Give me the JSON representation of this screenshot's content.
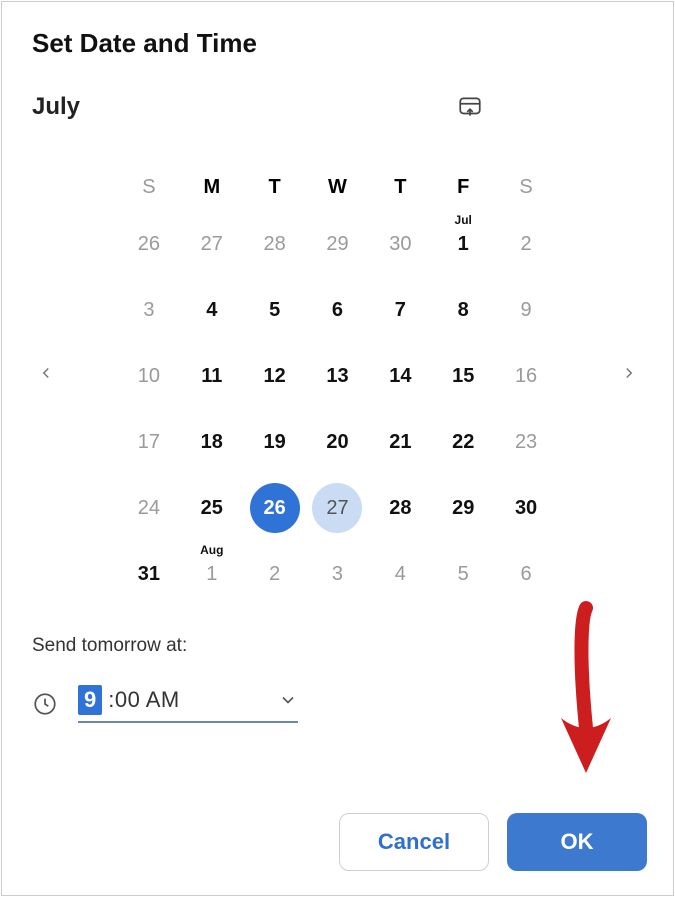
{
  "title": "Set Date and Time",
  "month": "July",
  "dow": [
    "S",
    "M",
    "T",
    "W",
    "T",
    "F",
    "S"
  ],
  "weeks": [
    [
      {
        "n": "26",
        "in": false
      },
      {
        "n": "27",
        "in": false
      },
      {
        "n": "28",
        "in": false
      },
      {
        "n": "29",
        "in": false
      },
      {
        "n": "30",
        "in": false
      },
      {
        "n": "1",
        "in": true,
        "tag": "Jul"
      },
      {
        "n": "2",
        "in": false
      }
    ],
    [
      {
        "n": "3",
        "in": false
      },
      {
        "n": "4",
        "in": true
      },
      {
        "n": "5",
        "in": true
      },
      {
        "n": "6",
        "in": true
      },
      {
        "n": "7",
        "in": true
      },
      {
        "n": "8",
        "in": true
      },
      {
        "n": "9",
        "in": false
      }
    ],
    [
      {
        "n": "10",
        "in": false
      },
      {
        "n": "11",
        "in": true
      },
      {
        "n": "12",
        "in": true
      },
      {
        "n": "13",
        "in": true
      },
      {
        "n": "14",
        "in": true
      },
      {
        "n": "15",
        "in": true
      },
      {
        "n": "16",
        "in": false
      }
    ],
    [
      {
        "n": "17",
        "in": false
      },
      {
        "n": "18",
        "in": true
      },
      {
        "n": "19",
        "in": true
      },
      {
        "n": "20",
        "in": true
      },
      {
        "n": "21",
        "in": true
      },
      {
        "n": "22",
        "in": true
      },
      {
        "n": "23",
        "in": false
      }
    ],
    [
      {
        "n": "24",
        "in": false
      },
      {
        "n": "25",
        "in": true
      },
      {
        "n": "26",
        "in": true,
        "selected": true
      },
      {
        "n": "27",
        "in": true,
        "highlight": true
      },
      {
        "n": "28",
        "in": true
      },
      {
        "n": "29",
        "in": true
      },
      {
        "n": "30",
        "in": true
      }
    ],
    [
      {
        "n": "31",
        "in": true
      },
      {
        "n": "1",
        "in": false,
        "tag": "Aug"
      },
      {
        "n": "2",
        "in": false
      },
      {
        "n": "3",
        "in": false
      },
      {
        "n": "4",
        "in": false
      },
      {
        "n": "5",
        "in": false
      },
      {
        "n": "6",
        "in": false
      }
    ]
  ],
  "send_label": "Send tomorrow at:",
  "time_hour": "9",
  "time_rest": ":00 AM",
  "cancel_label": "Cancel",
  "ok_label": "OK",
  "colors": {
    "primary": "#2f73d6",
    "highlight": "#c9dcf4"
  }
}
